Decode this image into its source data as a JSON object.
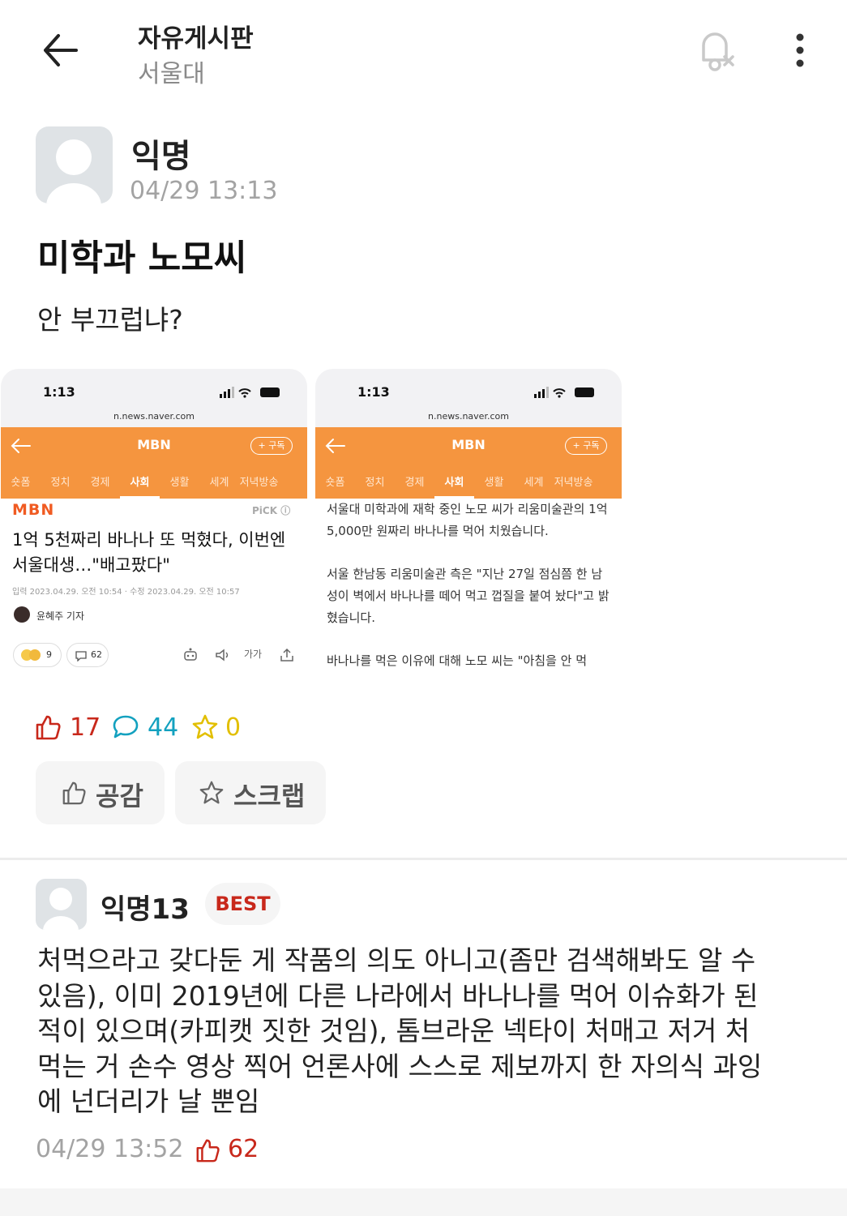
{
  "header": {
    "board_title": "자유게시판",
    "board_subtitle": "서울대",
    "icons": [
      "back-arrow-icon",
      "bell-off-icon",
      "more-vertical-icon"
    ]
  },
  "post": {
    "author": "익명",
    "date": "04/29 13:13",
    "title": "미학과 노모씨",
    "body": "안 부끄럽냐?",
    "likes": "17",
    "comments": "44",
    "scraps": "0",
    "colors": {
      "like": "#c8281b",
      "comment": "#13a1bf",
      "scrap": "#e2bf00"
    }
  },
  "actions": {
    "like_label": "공감",
    "scrap_label": "스크랩"
  },
  "screenshots": {
    "time": "1:13",
    "battery": "86",
    "url": "n.news.naver.com",
    "brand": "MBN",
    "subscribe": "+ 구독",
    "categories": [
      "숏폼",
      "정치",
      "경제",
      "사회",
      "생활",
      "세계",
      "저녁방송"
    ],
    "active_category": "사회",
    "brand_color": "#f5953f",
    "article1": {
      "logo": "MBN",
      "pick": "PiCK ⓘ",
      "headline": "1억 5천짜리 바나나 또 먹혔다, 이번엔 서울대생…\"배고팠다\"",
      "meta": "입력 2023.04.29. 오전 10:54 · 수정 2023.04.29. 오전 10:57",
      "reporter": "윤혜주 기자",
      "reaction_count": "9",
      "comment_count": "62",
      "font_size_label": "가가"
    },
    "article2": {
      "paragraphs": [
        "서울대 미학과에 재학 중인 노모 씨가 리움미술관의 1억 5,000만 원짜리 바나나를 먹어 치웠습니다.",
        "서울 한남동 리움미술관 측은 \"지난 27일 점심쯤 한 남성이 벽에서 바나나를 떼어 먹고 껍질을 붙여 놨다\"고 밝혔습니다.",
        "바나나를 먹은 이유에 대해 노모 씨는 \"아침을 안 먹"
      ]
    }
  },
  "comment": {
    "author": "익명13",
    "badge": "BEST",
    "lines": [
      "처먹으라고 갖다둔 게 작품의 의도 아니고(좀만 검색해봐도 알 수",
      "있음), 이미 2019년에 다른 나라에서 바나나를 먹어 이슈화가 된",
      "적이 있으며(카피캣 짓한 것임), 톰브라운 넥타이 처매고 저거 처",
      "먹는 거 손수 영상 찍어 언론사에 스스로 제보까지 한 자의식 과잉",
      "에 넌더리가 날 뿐임"
    ],
    "date": "04/29 13:52",
    "likes": "62"
  }
}
